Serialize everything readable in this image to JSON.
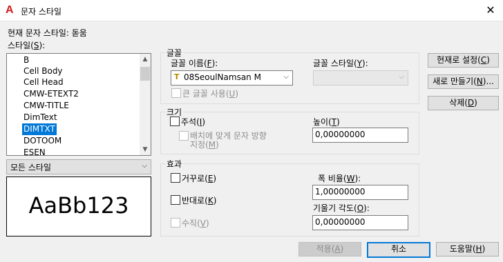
{
  "window": {
    "title": "문자 스타일",
    "close": "✕",
    "logo": "A"
  },
  "current_style": "현재 문자 스타일:  돋움",
  "styles_label": {
    "pre": "스타일(",
    "key": "S",
    "post": "):"
  },
  "style_list": [
    "B",
    "Cell Body",
    "Cell Head",
    "CMW-ETEXT2",
    "CMW-TITLE",
    "DimText",
    "DIMTXT",
    "DOTOOM",
    "ESEN"
  ],
  "selected_style": "DIMTXT",
  "filter_combo": "모든 스타일",
  "preview_text": "AaBb123",
  "font": {
    "group_title": "글꼴",
    "name_label": {
      "pre": "글꼴 이름(",
      "key": "F",
      "post": "):"
    },
    "name_value": "08SeoulNamsan M",
    "style_label": {
      "pre": "글꼴 스타일(",
      "key": "Y",
      "post": "):"
    },
    "style_value": "",
    "bigfont": {
      "pre": "큰 글꼴 사용(",
      "key": "U",
      "post": ")"
    }
  },
  "size": {
    "group_title": "크기",
    "annotative": {
      "pre": "주석(",
      "key": "I",
      "post": ")"
    },
    "match_orient_1": "배치에 맞게 문자 방향",
    "match_orient_2": {
      "pre": "지정(",
      "key": "M",
      "post": ")"
    },
    "height_label": {
      "pre": "높이(",
      "key": "T",
      "post": ")"
    },
    "height_value": "0,00000000"
  },
  "effects": {
    "group_title": "효과",
    "upside_down": {
      "pre": "거꾸로(",
      "key": "E",
      "post": ")"
    },
    "backwards": {
      "pre": "반대로(",
      "key": "K",
      "post": ")"
    },
    "vertical": {
      "pre": "수직(",
      "key": "V",
      "post": ")"
    },
    "width_label": {
      "pre": "폭 비율(",
      "key": "W",
      "post": "):"
    },
    "width_value": "1,00000000",
    "oblique_label": {
      "pre": "기울기 각도(",
      "key": "O",
      "post": "):"
    },
    "oblique_value": "0,00000000"
  },
  "buttons": {
    "set_current": {
      "pre": "현재로 설정(",
      "key": "C",
      "post": ")"
    },
    "new": {
      "pre": "새로 만들기(",
      "key": "N",
      "post": ")..."
    },
    "delete": {
      "pre": "삭제(",
      "key": "D",
      "post": ")"
    },
    "apply": {
      "pre": "적용(",
      "key": "A",
      "post": ")"
    },
    "cancel": "취소",
    "help": {
      "pre": "도움말(",
      "key": "H",
      "post": ")"
    }
  },
  "colors": {
    "accent": "#0078d7",
    "logo_red": "#d21d1d"
  }
}
